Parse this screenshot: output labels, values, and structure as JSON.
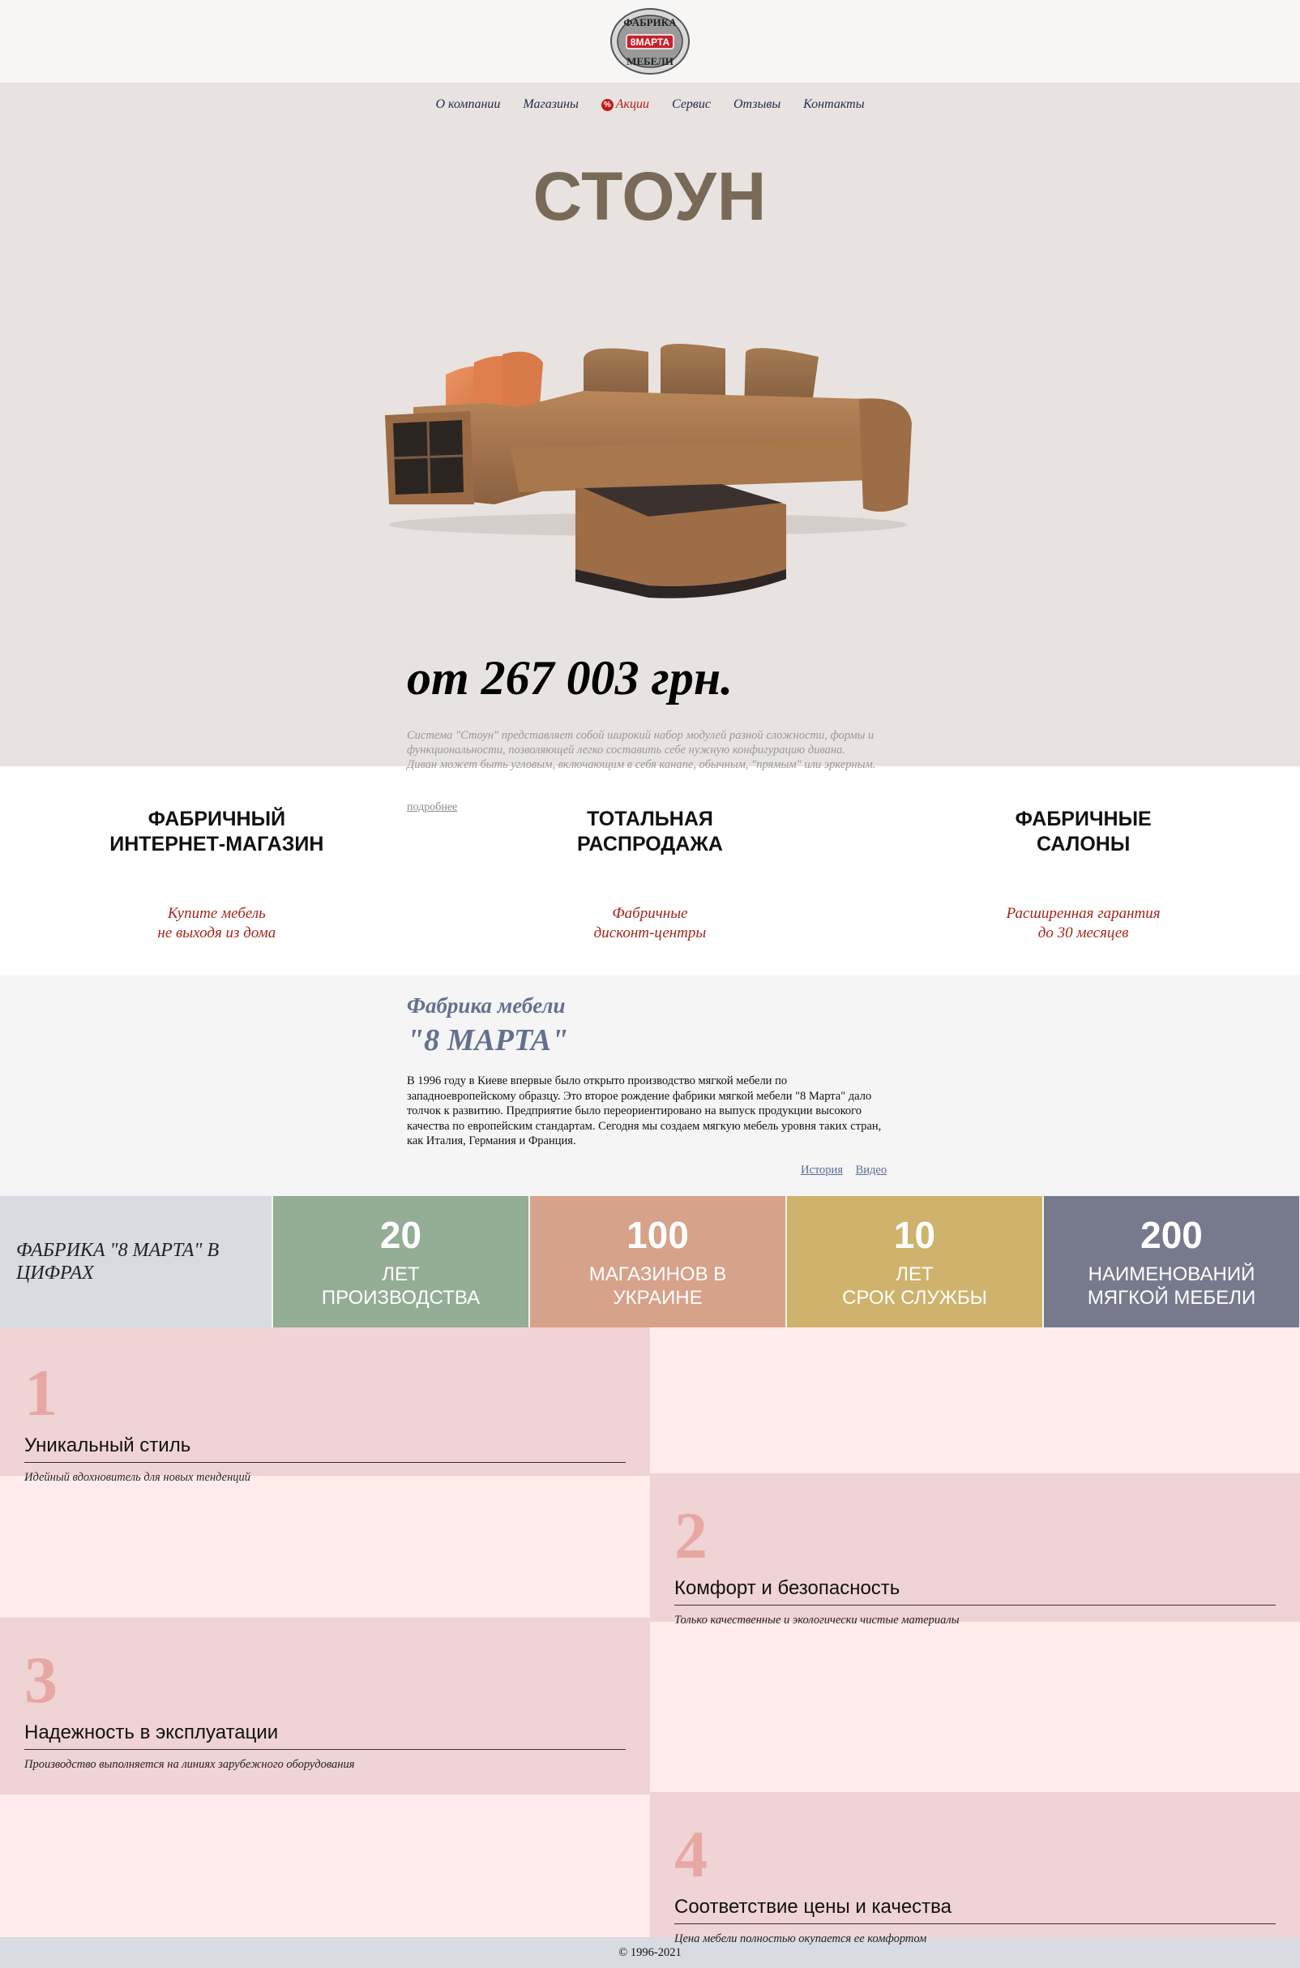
{
  "brand": {
    "logo_top": "ФАБРИКА",
    "logo_mid": "8МАРТА",
    "logo_bottom": "МЕБЕЛИ"
  },
  "nav": {
    "items": [
      {
        "label": "О компании"
      },
      {
        "label": "Магазины"
      },
      {
        "label": "Акции",
        "badge": "%"
      },
      {
        "label": "Сервис"
      },
      {
        "label": "Отзывы"
      },
      {
        "label": "Контакты"
      }
    ]
  },
  "hero": {
    "title": "СТОУН",
    "price": "от 267 003 грн.",
    "description": "Система \"Стоун\" представляет собой широкий набор модулей разной сложности, формы и функциональности, позволяющей легко составить себе нужную конфигурацию дивана. Диван может быть угловым, включающим в себя канапе, обычным, \"прямым\" или эркерным.",
    "more_link": "подробнее"
  },
  "features": [
    {
      "title": "ФАБРИЧНЫЙ\nИНТЕРНЕТ-МАГАЗИН",
      "subtitle": "Купите мебель\nне выходя из дома"
    },
    {
      "title": "ТОТАЛЬНАЯ\nРАСПРОДАЖА",
      "subtitle": "Фабричные\nдисконт-центры"
    },
    {
      "title": "ФАБРИЧНЫЕ\nСАЛОНЫ",
      "subtitle": "Расширенная гарантия\nдо 30 месяцев"
    }
  ],
  "about": {
    "title_line1": "Фабрика мебели",
    "title_line2": "\"8 МАРТА\"",
    "text": "В 1996 году в Киеве впервые было открыто производство мягкой мебели по западноевропейскому образцу. Это второе рождение фабрики мягкой мебели \"8 Марта\" дало толчок к развитию. Предприятие было переориентировано на выпуск продукции высокого качества по европейским стандартам. Сегодня мы создаем мягкую мебель уровня таких стран, как Италия, Германия и Франция.",
    "link_history": "История",
    "link_video": "Видео"
  },
  "stats": {
    "heading": "ФАБРИКА \"8 МАРТА\" В ЦИФРАХ",
    "items": [
      {
        "number": "20",
        "label": "ЛЕТ\nПРОИЗВОДСТВА",
        "color": "#94ad95"
      },
      {
        "number": "100",
        "label": "МАГАЗИНОВ В\nУКРАИНЕ",
        "color": "#d7a28a"
      },
      {
        "number": "10",
        "label": "ЛЕТ\nСРОК СЛУЖБЫ",
        "color": "#cfb26c"
      },
      {
        "number": "200",
        "label": "НАИМЕНОВАНИЙ\nМЯГКОЙ МЕБЕЛИ",
        "color": "#777a8d"
      }
    ]
  },
  "values": [
    {
      "number": "1",
      "title": "Уникальный стиль",
      "subtitle": "Идейный вдохновитель для новых тенденций"
    },
    {
      "number": "2",
      "title": "Комфорт и безопасность",
      "subtitle": "Только качественные и экологически чистые материалы"
    },
    {
      "number": "3",
      "title": "Надежность в эксплуатации",
      "subtitle": "Производство выполняется на линиях зарубежного оборудования"
    },
    {
      "number": "4",
      "title": "Соответствие цены и качества",
      "subtitle": "Цена мебели полностью окупается ее комфортом"
    }
  ],
  "footer": {
    "copyright": "© 1996-2021"
  },
  "colors": {
    "hero_bg": "#e8e3e0",
    "title_color": "#786a57",
    "feature_sub": "#a3261c",
    "about_title": "#64718e",
    "value_block": "#f0d3d4",
    "value_bg": "#ffeceb",
    "value_number": "#e7a7a2"
  }
}
